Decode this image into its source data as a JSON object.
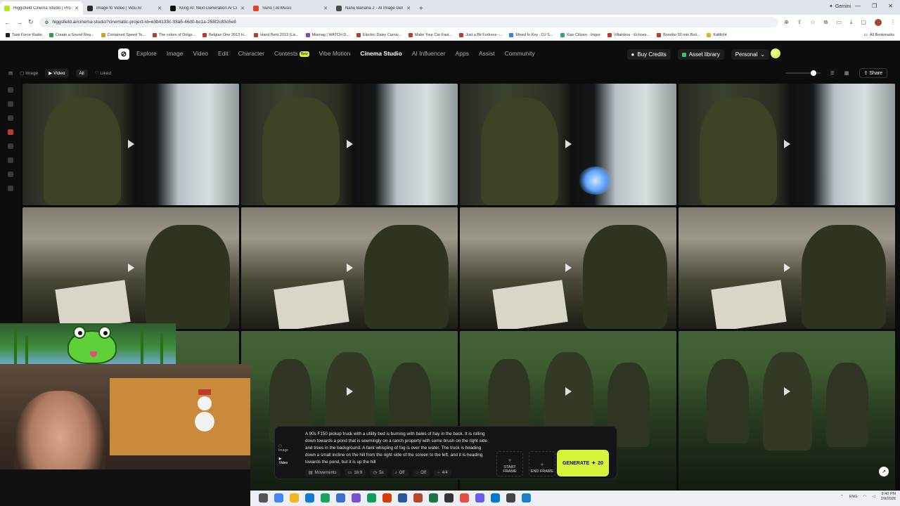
{
  "browser": {
    "tabs": [
      {
        "title": "Higgsfield Cinema Studio | Prof",
        "color": "#b5e61d",
        "active": true
      },
      {
        "title": "Image to Video | Vidu AI",
        "color": "#2b2b2b",
        "active": false
      },
      {
        "title": "Kling AI: Next-Generation AI Cr",
        "color": "#111111",
        "active": false
      },
      {
        "title": "Suno | AI Music",
        "color": "#e0452b",
        "active": false
      },
      {
        "title": "Nano Banana 2 - AI Image Gen",
        "color": "#4a4a4a",
        "active": false
      }
    ],
    "new_tab": "+",
    "gemini": "Gemini",
    "url": "higgsfield.ai/cinema-studio?cinematic-project-id=e3b4133c-33a5-46d0-bc1a-258f2c83c5e8",
    "bookmarks": [
      "Task Force Radio",
      "Create a Sound Rea...",
      "Contained Speed To...",
      "The colors of Dolgo...",
      "Belgian One 2013 H...",
      "Hand Bent 2013 (Liv...",
      "Mismag | WATCH D...",
      "Electric Daisy Carniv...",
      "Make Your Car Fast...",
      "Just a Bit Fortress -...",
      "Mixed In Key - DJ S...",
      "Xiao Citizen - Imgur",
      "Villalobos - Echoes...",
      "Bonobo 50 min Boil...",
      "Kaltlicht"
    ],
    "all_bookmarks": "All Bookmarks"
  },
  "site": {
    "nav": [
      "Explore",
      "Image",
      "Video",
      "Edit",
      "Character",
      "Contests",
      "Vibe Motion",
      "Cinema Studio",
      "AI Influencer",
      "Apps",
      "Assist",
      "Community"
    ],
    "active_nav": "Cinema Studio",
    "new_badge": "New",
    "buy_credits": "Buy Credits",
    "asset_library": "Asset library",
    "workspace": "Personal",
    "filters": {
      "image": "Image",
      "video": "Video",
      "all": "All",
      "liked": "Liked"
    },
    "share": "Share"
  },
  "grid": {
    "rows": [
      {
        "scene": "window-soldier",
        "count": 4
      },
      {
        "scene": "sniper",
        "count": 4
      },
      {
        "scene": "jungle-squad",
        "count": 4
      }
    ]
  },
  "prompt": {
    "modes": [
      "Image",
      "Video"
    ],
    "text": "A 90s F150 pickup truck with a utility bed is burning with bales of hay in the back. It is rolling down towards a pond that is seemingly on a ranch property with some brush on the right side and trees in the background. A faint whisping of fog is over the water. The truck is heading down a small incline on the hill from the right side of the screen to the left, and it is heading towards the pond, but it is up the hill",
    "movements": "Movements",
    "aspect": "16:9",
    "duration": "5s",
    "audio": "Off",
    "extra": "Off",
    "count": "4/4",
    "start_frame": "START FRAME",
    "end_frame": "END FRAME",
    "generate": "GENERATE",
    "credits": "20"
  },
  "taskbar": {
    "lang": "ENG",
    "time": "9:40 PM",
    "date": "2/9/2026"
  },
  "colors": {
    "accent": "#d7f33a",
    "bg": "#0b0b0c"
  }
}
